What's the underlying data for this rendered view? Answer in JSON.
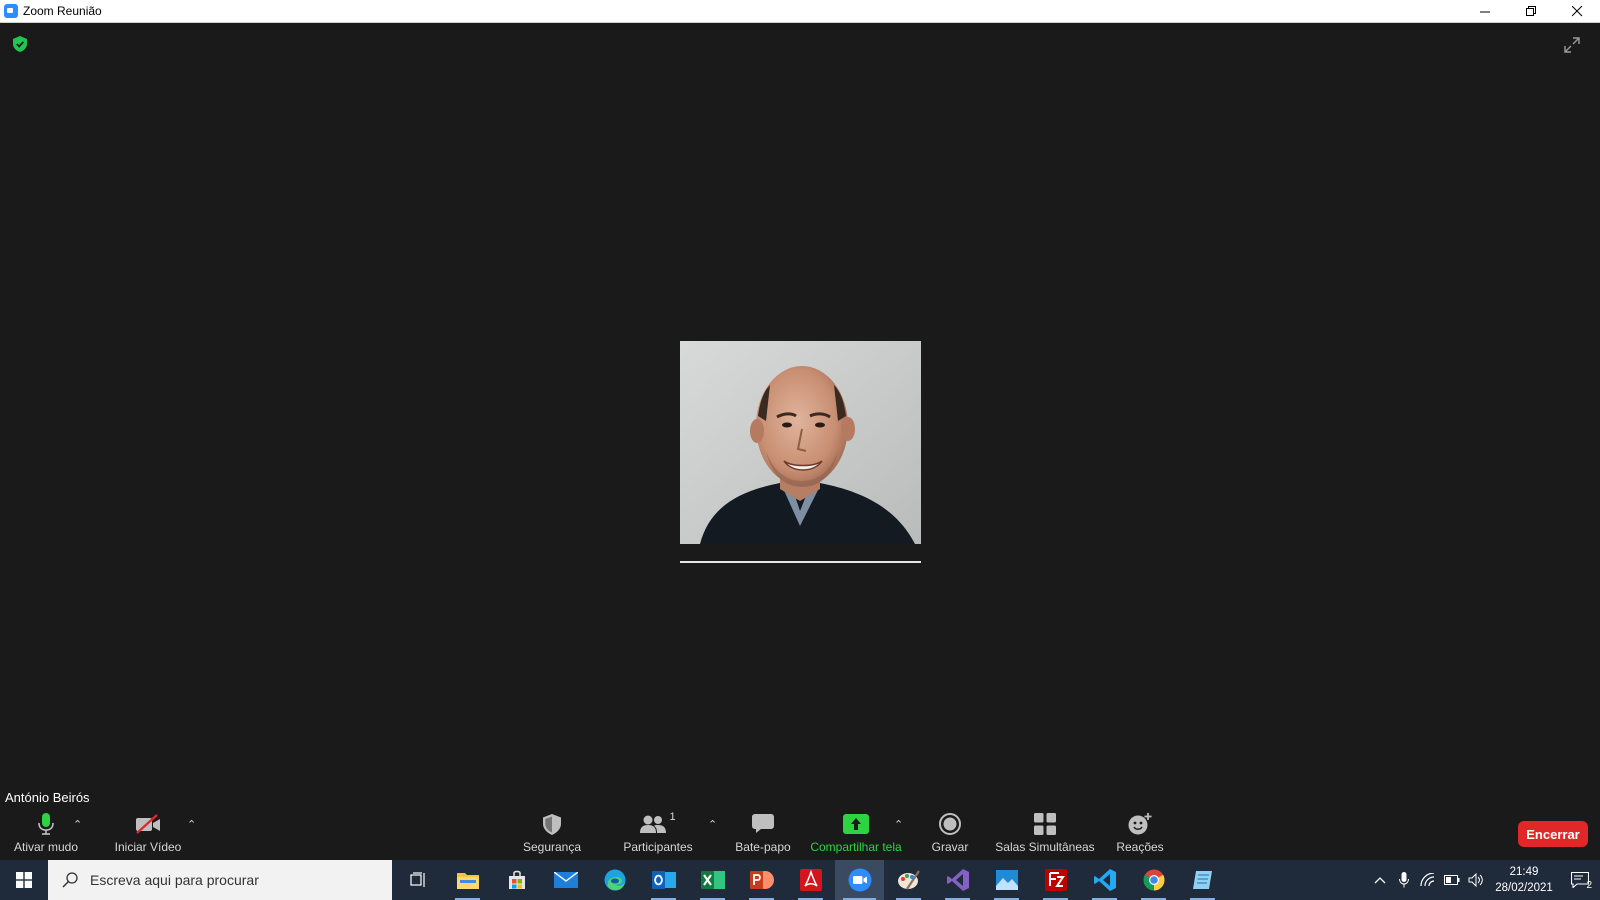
{
  "window": {
    "title": "Zoom Reunião",
    "controls": [
      "minimize",
      "restore",
      "close"
    ]
  },
  "meeting": {
    "participant_name": "António Beirós",
    "encryption_icon": "shield-check-icon",
    "fullscreen_icon": "expand-icon"
  },
  "toolbar": {
    "mute": {
      "label": "Ativar mudo",
      "icon": "microphone-icon"
    },
    "video": {
      "label": "Iniciar Vídeo",
      "icon": "video-off-icon"
    },
    "security": {
      "label": "Segurança",
      "icon": "shield-icon"
    },
    "participants": {
      "label": "Participantes",
      "count": "1",
      "icon": "participants-icon"
    },
    "chat": {
      "label": "Bate-papo",
      "icon": "chat-icon"
    },
    "share": {
      "label": "Compartilhar tela",
      "icon": "share-screen-icon",
      "color": "#2ed341"
    },
    "record": {
      "label": "Gravar",
      "icon": "record-icon"
    },
    "breakout": {
      "label": "Salas Simultâneas",
      "icon": "breakout-rooms-icon"
    },
    "reactions": {
      "label": "Reações",
      "icon": "reactions-icon"
    },
    "end": {
      "label": "Encerrar",
      "color": "#e02828"
    }
  },
  "taskbar": {
    "search_placeholder": "Escreva aqui para procurar",
    "apps": [
      "task-view",
      "file-explorer",
      "store",
      "mail",
      "edge",
      "outlook",
      "excel",
      "powerpoint",
      "acrobat",
      "zoom",
      "paint",
      "visual-studio",
      "photos",
      "filezilla",
      "vscode",
      "chrome",
      "notepad"
    ],
    "time": "21:49",
    "date": "28/02/2021",
    "notifications_count": "2"
  }
}
